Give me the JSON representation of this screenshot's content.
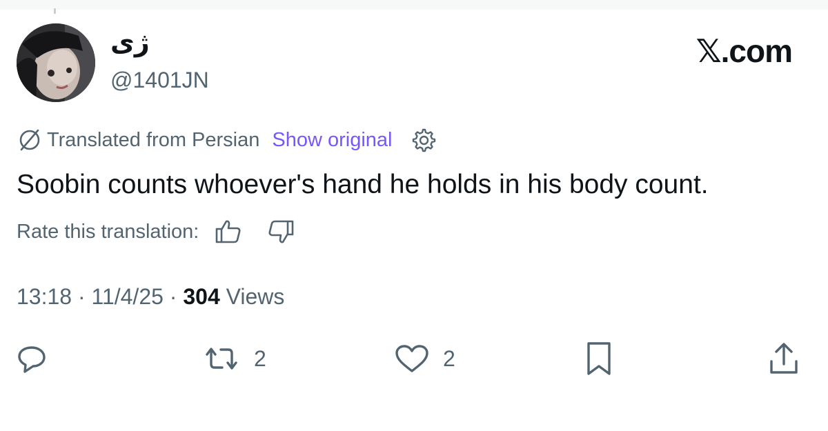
{
  "user": {
    "display_name": "ژی",
    "handle": "@1401JN"
  },
  "brand": "𝕏.com",
  "translation": {
    "label": "Translated from Persian",
    "show_original": "Show original"
  },
  "tweet": {
    "text": "Soobin counts whoever's hand he holds in his body count."
  },
  "rating": {
    "label": "Rate this translation:"
  },
  "meta": {
    "time": "13:18",
    "separator_1": " · ",
    "date": "11/4/25",
    "separator_2": " · ",
    "views_count": "304",
    "views_label": " Views"
  },
  "actions": {
    "reply_icon": "reply-icon",
    "retweet_icon": "retweet-icon",
    "retweet_count": "2",
    "like_icon": "heart-icon",
    "like_count": "2",
    "bookmark_icon": "bookmark-icon",
    "share_icon": "share-icon"
  },
  "colors": {
    "text_primary": "#0f1419",
    "text_secondary": "#536471",
    "link_accent": "#7856ff",
    "background": "#ffffff"
  }
}
